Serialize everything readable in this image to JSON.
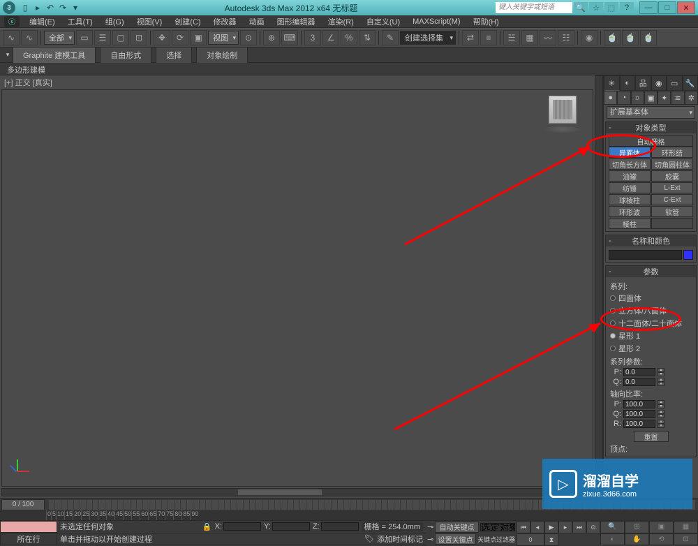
{
  "titlebar": {
    "app_title": "Autodesk 3ds Max 2012 x64   无标题",
    "search_placeholder": "键入关键字或短语",
    "tool_icons": [
      "new-icon",
      "open-icon",
      "save-icon",
      "undo-icon",
      "redo-icon"
    ]
  },
  "menus": [
    "编辑(E)",
    "工具(T)",
    "组(G)",
    "视图(V)",
    "创建(C)",
    "修改器",
    "动画",
    "图形编辑器",
    "渲染(R)",
    "自定义(U)",
    "MAXScript(M)",
    "帮助(H)"
  ],
  "toolbar": {
    "scope_combo": "全部",
    "view_combo": "视图",
    "selset_combo": "创建选择集"
  },
  "ribbon": {
    "tabs": [
      "Graphite 建模工具",
      "自由形式",
      "选择",
      "对象绘制"
    ],
    "sub": "多边形建模"
  },
  "viewport": {
    "label": "[+] 正交 [真实]"
  },
  "panel": {
    "combo": "扩展基本体",
    "rollout_objtype": "对象类型",
    "autogrid": "自动栅格",
    "buttons": [
      [
        "异面体",
        "环形结"
      ],
      [
        "切角长方体",
        "切角圆柱体"
      ],
      [
        "油罐",
        "胶囊"
      ],
      [
        "纺锤",
        "L-Ext"
      ],
      [
        "球棱柱",
        "C-Ext"
      ],
      [
        "环形波",
        "软管"
      ],
      [
        "棱柱",
        ""
      ]
    ],
    "selected_button": "异面体",
    "rollout_namecolor": "名称和颜色",
    "rollout_params": "参数",
    "series_label": "系列:",
    "series_options": [
      "四面体",
      "立方体/八面体",
      "十二面体/二十面体",
      "星形 1",
      "星形 2"
    ],
    "series_selected": "星形 1",
    "series_params_label": "系列参数:",
    "spinners_series": [
      {
        "label": "P:",
        "value": "0.0"
      },
      {
        "label": "Q:",
        "value": "0.0"
      }
    ],
    "axis_ratio_label": "轴向比率:",
    "spinners_axis": [
      {
        "label": "P:",
        "value": "100.0"
      },
      {
        "label": "Q:",
        "value": "100.0"
      },
      {
        "label": "R:",
        "value": "100.0"
      }
    ],
    "reset_btn": "重置",
    "vertex_label": "顶点:"
  },
  "timeline": {
    "slider": "0 / 100",
    "ticks": [
      "0",
      "5",
      "10",
      "15",
      "20",
      "25",
      "30",
      "35",
      "40",
      "45",
      "50",
      "55",
      "60",
      "65",
      "70",
      "75",
      "80",
      "85",
      "90"
    ]
  },
  "status": {
    "cur_label": "所在行",
    "msg1": "未选定任何对象",
    "msg2": "单击并拖动以开始创建过程",
    "add_time": "添加时间标记",
    "coords": {
      "x": "X:",
      "y": "Y:",
      "z": "Z:"
    },
    "grid": "栅格 = 254.0mm",
    "autokey": "自动关键点",
    "setkey": "设置关键点",
    "selset": "选定对象",
    "keyfilter": "关键点过滤器"
  },
  "watermark": {
    "big": "溜溜自学",
    "small": "zixue.3d66.com"
  }
}
